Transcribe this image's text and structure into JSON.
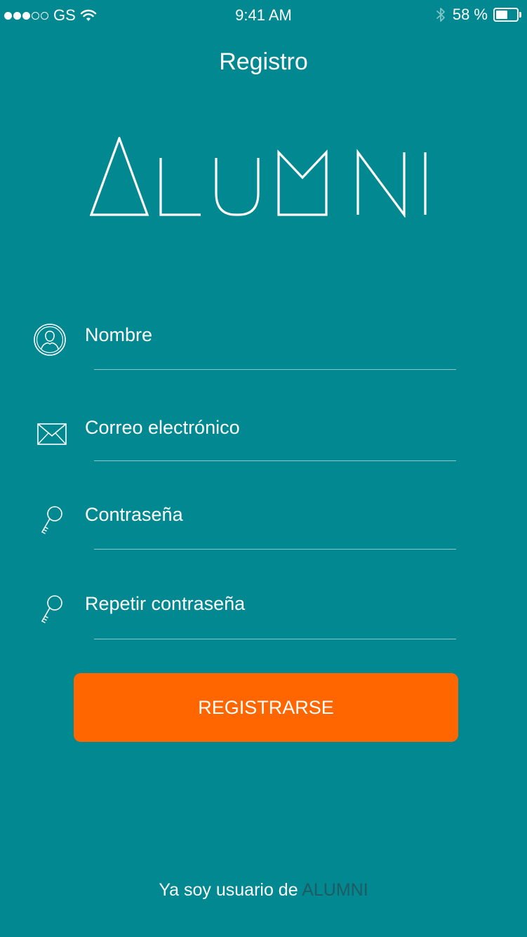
{
  "status_bar": {
    "carrier": "GS",
    "time": "9:41 AM",
    "battery_percent": "58 %",
    "battery_level": 0.58,
    "signal_bars_filled": 3,
    "signal_bars_total": 5
  },
  "header": {
    "title": "Registro"
  },
  "logo": {
    "text": "ALUMNI",
    "icon": "alumni-logo"
  },
  "form": {
    "name": {
      "placeholder": "Nombre",
      "value": "",
      "icon": "user-icon"
    },
    "email": {
      "placeholder": "Correo electrónico",
      "value": "",
      "icon": "envelope-icon"
    },
    "password": {
      "placeholder": "Contraseña",
      "value": "",
      "icon": "key-icon"
    },
    "password_repeat": {
      "placeholder": "Repetir contraseña",
      "value": "",
      "icon": "key-icon"
    }
  },
  "register_button": {
    "label": "REGISTRARSE"
  },
  "footer": {
    "prefix": "Ya soy usuario de ",
    "link": "ALUMNI"
  },
  "colors": {
    "background": "#018891",
    "button": "#ff6600",
    "link": "#1f5b63"
  }
}
